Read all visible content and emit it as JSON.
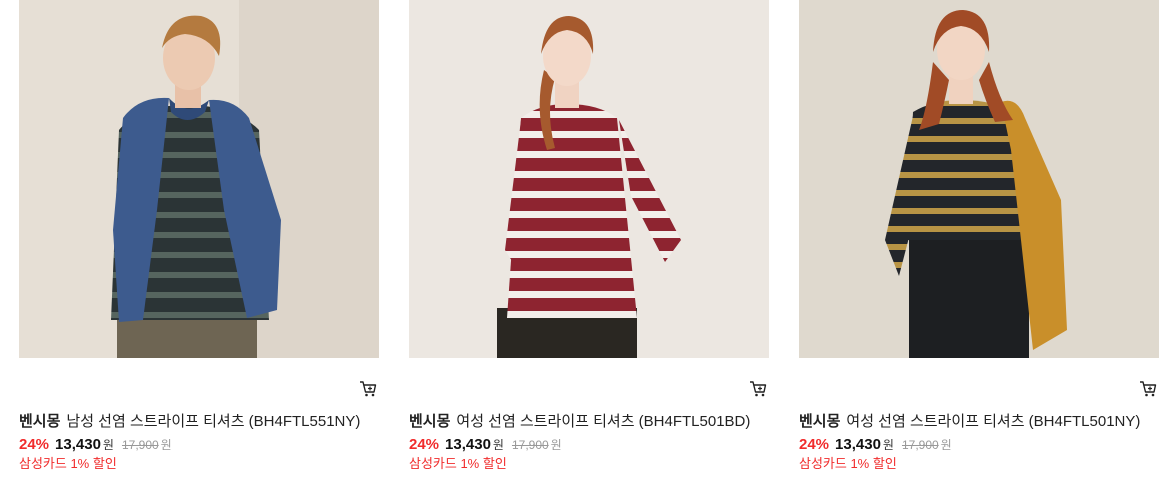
{
  "products": [
    {
      "brand": "벤시몽",
      "title": "남성 선염 스트라이프 티셔츠 (BH4FTL551NY)",
      "discount_rate": "24%",
      "sale_price": "13,430",
      "price_unit": "원",
      "original_price": "17,900",
      "original_unit": "원",
      "promo": "삼성카드 1% 할인",
      "image_desc": "man in navy/grey striped long-sleeve tee with blue cardigan over shoulders",
      "colors": {
        "stripe_a": "#2b3436",
        "stripe_b": "#56655f",
        "accent": "#3d5b8e"
      },
      "icon": "cart-icon"
    },
    {
      "brand": "벤시몽",
      "title": "여성 선염 스트라이프 티셔츠 (BH4FTL501BD)",
      "discount_rate": "24%",
      "sale_price": "13,430",
      "price_unit": "원",
      "original_price": "17,900",
      "original_unit": "원",
      "promo": "삼성카드 1% 할인",
      "image_desc": "woman in burgundy/white striped long-sleeve tee",
      "colors": {
        "stripe_a": "#8e2430",
        "stripe_b": "#f3eeea",
        "accent": "#2a2722"
      },
      "icon": "cart-icon"
    },
    {
      "brand": "벤시몽",
      "title": "여성 선염 스트라이프 티셔츠 (BH4FTL501NY)",
      "discount_rate": "24%",
      "sale_price": "13,430",
      "price_unit": "원",
      "original_price": "17,900",
      "original_unit": "원",
      "promo": "삼성카드 1% 할인",
      "image_desc": "woman in navy/mustard striped long-sleeve tee holding mustard jacket",
      "colors": {
        "stripe_a": "#23262b",
        "stripe_b": "#b89445",
        "accent": "#c98f2a"
      },
      "icon": "cart-icon"
    }
  ]
}
